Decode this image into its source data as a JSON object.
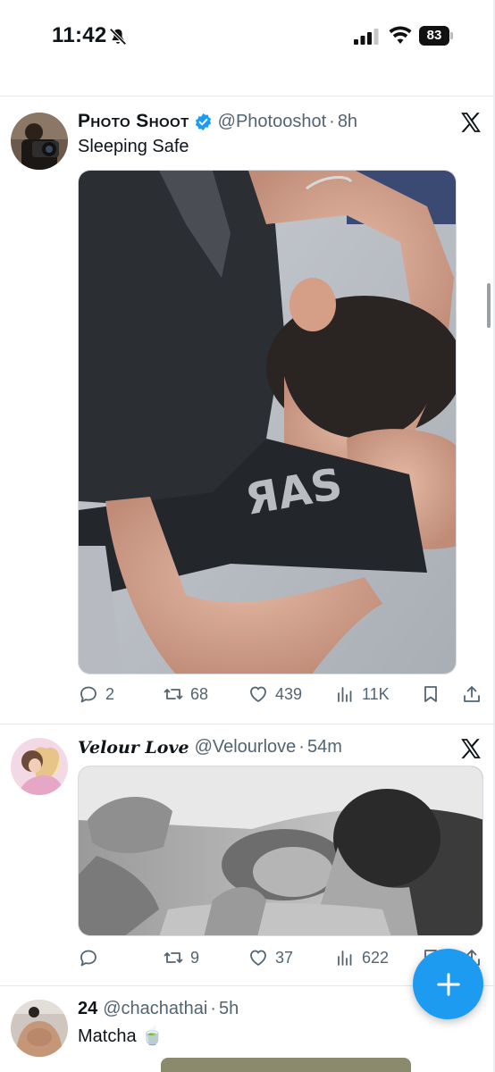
{
  "status_bar": {
    "time": "11:42",
    "battery": "83"
  },
  "tweets": [
    {
      "author": "Photo Shoot",
      "verified": true,
      "handle": "@Photooshot",
      "separator": "·",
      "time_ago": "8h",
      "text": "Sleeping Safe",
      "stats": {
        "replies": "2",
        "retweets": "68",
        "likes": "439",
        "views": "11K"
      }
    },
    {
      "author": "Velour Love",
      "verified": false,
      "handle": "@Velourlove",
      "separator": "·",
      "time_ago": "54m",
      "text": "",
      "stats": {
        "replies": "",
        "retweets": "9",
        "likes": "37",
        "views": "622"
      }
    },
    {
      "author": "24",
      "verified": false,
      "handle": "@chachathai",
      "separator": "·",
      "time_ago": "5h",
      "text": "Matcha 🍵"
    }
  ],
  "colors": {
    "accent": "#1d9bf0",
    "secondary_text": "#536471",
    "primary_text": "#0f1419"
  },
  "icons": [
    "bell-slash-icon",
    "cellular-signal-icon",
    "wifi-icon",
    "battery-icon",
    "verified-badge-icon",
    "x-logo-icon",
    "reply-icon",
    "retweet-icon",
    "like-icon",
    "views-icon",
    "bookmark-icon",
    "share-icon",
    "compose-plus-icon"
  ]
}
